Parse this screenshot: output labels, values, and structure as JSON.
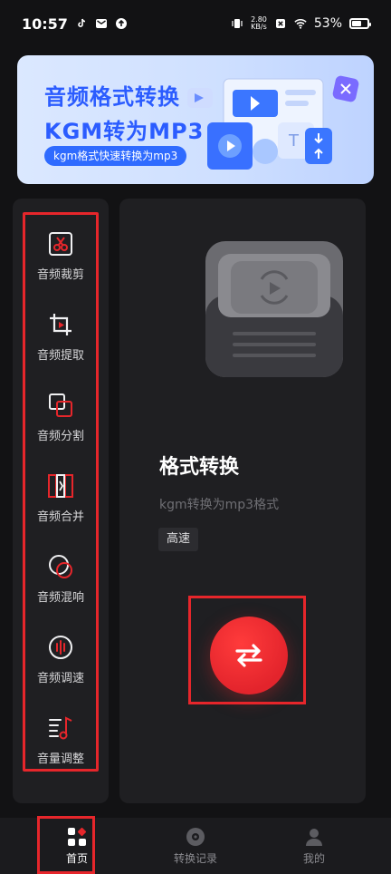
{
  "status_bar": {
    "time": "10:57",
    "net_speed_top": "2.80",
    "net_speed_bottom": "KB/s",
    "battery": "53%"
  },
  "banner": {
    "title_line1": "音频格式转换",
    "title_line2": "KGM转为MP3",
    "pill": "kgm格式快速转换为mp3"
  },
  "tools": [
    {
      "label": "音频裁剪",
      "icon": "scissors-icon"
    },
    {
      "label": "音频提取",
      "icon": "crop-icon"
    },
    {
      "label": "音频分割",
      "icon": "split-squares-icon"
    },
    {
      "label": "音频合并",
      "icon": "merge-bars-icon"
    },
    {
      "label": "音频混响",
      "icon": "overlap-circles-icon"
    },
    {
      "label": "音频调速",
      "icon": "waveform-circle-icon"
    },
    {
      "label": "音量调整",
      "icon": "music-note-list-icon"
    }
  ],
  "card": {
    "title": "格式转换",
    "subtitle": "kgm转换为mp3格式",
    "badge": "高速"
  },
  "nav": {
    "home": "首页",
    "history": "转换记录",
    "profile": "我的"
  },
  "colors": {
    "accent": "#e6262b",
    "banner_text": "#2b5cff",
    "background": "#121214",
    "panel": "#1f1f22"
  }
}
